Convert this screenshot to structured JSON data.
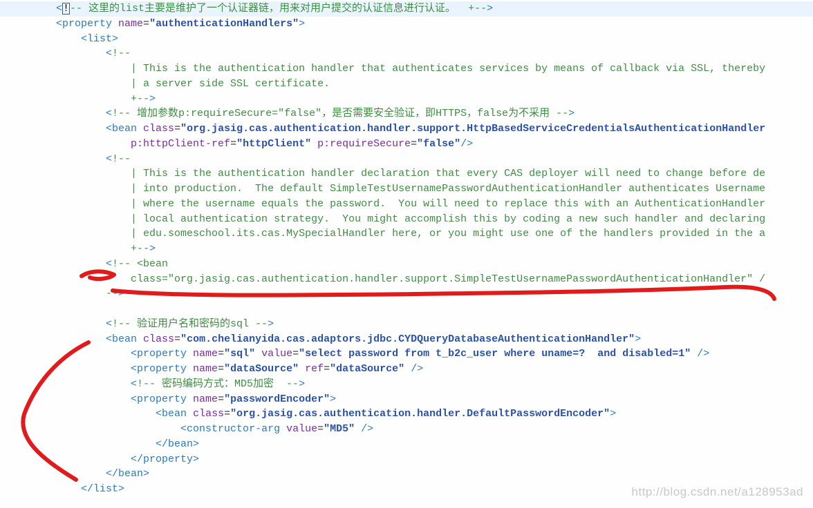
{
  "watermark": "http://blog.csdn.net/a128953ad",
  "lines": [
    {
      "indent": 1,
      "hl": true,
      "segs": [
        {
          "cls": "c-tag",
          "t": "<"
        },
        {
          "cls": "cursor",
          "t": "!"
        },
        {
          "cls": "c-comment",
          "t": "-- 这里的list主要是维护了一个认证器链，用来对用户提交的认证信息进行认证。  +--"
        },
        {
          "cls": "c-tag",
          "t": ">"
        }
      ]
    },
    {
      "indent": 1,
      "segs": [
        {
          "cls": "c-tag",
          "t": "<property "
        },
        {
          "cls": "c-attrname",
          "t": "name"
        },
        {
          "cls": "c-text",
          "t": "="
        },
        {
          "cls": "c-attrval",
          "t": "\"authenticationHandlers\""
        },
        {
          "cls": "c-tag",
          "t": ">"
        }
      ]
    },
    {
      "indent": 2,
      "segs": [
        {
          "cls": "c-tag",
          "t": "<list>"
        }
      ]
    },
    {
      "indent": 3,
      "segs": [
        {
          "cls": "c-tag",
          "t": "<"
        },
        {
          "cls": "c-comment",
          "t": "!--"
        }
      ]
    },
    {
      "indent": 4,
      "segs": [
        {
          "cls": "c-comment",
          "t": "| This is the authentication handler that authenticates services by means of callback via SSL, thereby"
        }
      ]
    },
    {
      "indent": 4,
      "segs": [
        {
          "cls": "c-comment",
          "t": "| a server side SSL certificate."
        }
      ]
    },
    {
      "indent": 4,
      "segs": [
        {
          "cls": "c-comment",
          "t": "+--"
        },
        {
          "cls": "c-tag",
          "t": ">"
        }
      ]
    },
    {
      "indent": 3,
      "segs": [
        {
          "cls": "c-tag",
          "t": "<"
        },
        {
          "cls": "c-comment",
          "t": "!-- 增加参数p:requireSecure=\"false\"，是否需要安全验证，即HTTPS，false为不采用 --"
        },
        {
          "cls": "c-tag",
          "t": ">"
        }
      ]
    },
    {
      "indent": 3,
      "segs": [
        {
          "cls": "c-tag",
          "t": "<bean "
        },
        {
          "cls": "c-attrname",
          "t": "class"
        },
        {
          "cls": "c-text",
          "t": "="
        },
        {
          "cls": "c-attrval",
          "t": "\"org.jasig.cas.authentication.handler.support.HttpBasedServiceCredentialsAuthenticationHandler"
        }
      ]
    },
    {
      "indent": 4,
      "segs": [
        {
          "cls": "c-attrname",
          "t": "p:httpClient-ref"
        },
        {
          "cls": "c-text",
          "t": "="
        },
        {
          "cls": "c-attrval",
          "t": "\"httpClient\""
        },
        {
          "cls": "c-text",
          "t": " "
        },
        {
          "cls": "c-attrname",
          "t": "p:requireSecure"
        },
        {
          "cls": "c-text",
          "t": "="
        },
        {
          "cls": "c-attrval",
          "t": "\"false\""
        },
        {
          "cls": "c-tag",
          "t": "/>"
        }
      ]
    },
    {
      "indent": 3,
      "segs": [
        {
          "cls": "c-tag",
          "t": "<"
        },
        {
          "cls": "c-comment",
          "t": "!--"
        }
      ]
    },
    {
      "indent": 4,
      "segs": [
        {
          "cls": "c-comment",
          "t": "| This is the authentication handler declaration that every CAS deployer will need to change before de"
        }
      ]
    },
    {
      "indent": 4,
      "segs": [
        {
          "cls": "c-comment",
          "t": "| into production.  The default SimpleTestUsernamePasswordAuthenticationHandler authenticates Username"
        }
      ]
    },
    {
      "indent": 4,
      "segs": [
        {
          "cls": "c-comment",
          "t": "| where the username equals the password.  You will need to replace this with an AuthenticationHandler"
        }
      ]
    },
    {
      "indent": 4,
      "segs": [
        {
          "cls": "c-comment",
          "t": "| local authentication strategy.  You might accomplish this by coding a new such handler and declaring"
        }
      ]
    },
    {
      "indent": 4,
      "segs": [
        {
          "cls": "c-comment",
          "t": "| edu.someschool.its.cas.MySpecialHandler here, or you might use one of the handlers provided in the a"
        }
      ]
    },
    {
      "indent": 4,
      "segs": [
        {
          "cls": "c-comment",
          "t": "+--"
        },
        {
          "cls": "c-tag",
          "t": ">"
        }
      ]
    },
    {
      "indent": 3,
      "segs": [
        {
          "cls": "c-tag",
          "t": "<"
        },
        {
          "cls": "c-comment",
          "t": "!-- <bean"
        }
      ]
    },
    {
      "indent": 4,
      "segs": [
        {
          "cls": "c-comment",
          "t": "class=\"org.jasig.cas.authentication.handler.support.SimpleTestUsernamePasswordAuthenticationHandler\" /"
        }
      ]
    },
    {
      "indent": 3,
      "segs": [
        {
          "cls": "c-comment",
          "t": "--"
        },
        {
          "cls": "c-tag",
          "t": ">"
        }
      ]
    },
    {
      "indent": 0,
      "segs": [
        {
          "cls": "c-text",
          "t": " "
        }
      ]
    },
    {
      "indent": 3,
      "segs": [
        {
          "cls": "c-tag",
          "t": "<"
        },
        {
          "cls": "c-comment",
          "t": "!-- 验证用户名和密码的sql --"
        },
        {
          "cls": "c-tag",
          "t": ">"
        }
      ]
    },
    {
      "indent": 3,
      "segs": [
        {
          "cls": "c-tag",
          "t": "<bean "
        },
        {
          "cls": "c-attrname",
          "t": "class"
        },
        {
          "cls": "c-text",
          "t": "="
        },
        {
          "cls": "c-attrval",
          "t": "\"com.chelianyida.cas.adaptors.jdbc.CYDQueryDatabaseAuthenticationHandler\""
        },
        {
          "cls": "c-tag",
          "t": ">"
        }
      ]
    },
    {
      "indent": 4,
      "segs": [
        {
          "cls": "c-tag",
          "t": "<property "
        },
        {
          "cls": "c-attrname",
          "t": "name"
        },
        {
          "cls": "c-text",
          "t": "="
        },
        {
          "cls": "c-attrval",
          "t": "\"sql\""
        },
        {
          "cls": "c-text",
          "t": " "
        },
        {
          "cls": "c-attrname",
          "t": "value"
        },
        {
          "cls": "c-text",
          "t": "="
        },
        {
          "cls": "c-attrval",
          "t": "\"select password from t_b2c_user where uname=?  and disabled=1\""
        },
        {
          "cls": "c-tag",
          "t": " />"
        }
      ]
    },
    {
      "indent": 4,
      "segs": [
        {
          "cls": "c-tag",
          "t": "<property "
        },
        {
          "cls": "c-attrname",
          "t": "name"
        },
        {
          "cls": "c-text",
          "t": "="
        },
        {
          "cls": "c-attrval",
          "t": "\"dataSource\""
        },
        {
          "cls": "c-text",
          "t": " "
        },
        {
          "cls": "c-attrname",
          "t": "ref"
        },
        {
          "cls": "c-text",
          "t": "="
        },
        {
          "cls": "c-attrval",
          "t": "\"dataSource\""
        },
        {
          "cls": "c-tag",
          "t": " />"
        }
      ]
    },
    {
      "indent": 4,
      "segs": [
        {
          "cls": "c-tag",
          "t": "<"
        },
        {
          "cls": "c-comment",
          "t": "!-- 密码编码方式：MD5加密  --"
        },
        {
          "cls": "c-tag",
          "t": ">"
        }
      ]
    },
    {
      "indent": 4,
      "segs": [
        {
          "cls": "c-tag",
          "t": "<property "
        },
        {
          "cls": "c-attrname",
          "t": "name"
        },
        {
          "cls": "c-text",
          "t": "="
        },
        {
          "cls": "c-attrval",
          "t": "\"passwordEncoder\""
        },
        {
          "cls": "c-tag",
          "t": ">"
        }
      ]
    },
    {
      "indent": 5,
      "segs": [
        {
          "cls": "c-tag",
          "t": "<bean "
        },
        {
          "cls": "c-attrname",
          "t": "class"
        },
        {
          "cls": "c-text",
          "t": "="
        },
        {
          "cls": "c-attrval",
          "t": "\"org.jasig.cas.authentication.handler.DefaultPasswordEncoder\""
        },
        {
          "cls": "c-tag",
          "t": ">"
        }
      ]
    },
    {
      "indent": 6,
      "segs": [
        {
          "cls": "c-tag",
          "t": "<constructor-arg "
        },
        {
          "cls": "c-attrname",
          "t": "value"
        },
        {
          "cls": "c-text",
          "t": "="
        },
        {
          "cls": "c-attrval",
          "t": "\"MD5\""
        },
        {
          "cls": "c-tag",
          "t": " />"
        }
      ]
    },
    {
      "indent": 5,
      "segs": [
        {
          "cls": "c-tag",
          "t": "</bean>"
        }
      ]
    },
    {
      "indent": 4,
      "segs": [
        {
          "cls": "c-tag",
          "t": "</property>"
        }
      ]
    },
    {
      "indent": 3,
      "segs": [
        {
          "cls": "c-tag",
          "t": "</bean>"
        }
      ]
    },
    {
      "indent": 2,
      "segs": [
        {
          "cls": "c-tag",
          "t": "</list>"
        }
      ]
    }
  ]
}
